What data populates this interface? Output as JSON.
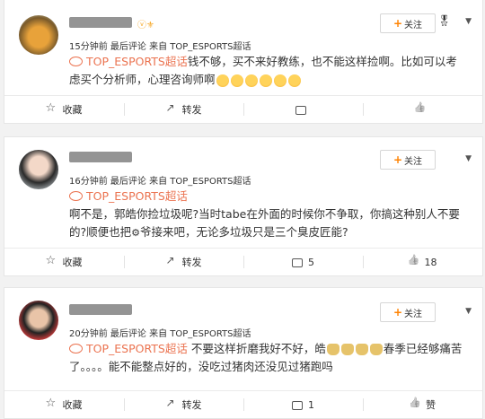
{
  "comments": [
    {
      "meta": "15分钟前 最后评论 来自 TOP_ESPORTS超话",
      "follow_label": "关注",
      "topic": "TOP_ESPORTS超话",
      "text_line1": "钱不够，买不来好教练，也不能这样捡啊。比如可以考",
      "text_line2": "虑买个分析师，心理咨询师啊",
      "actions": {
        "collect": "收藏",
        "repost": "转发",
        "comment": "",
        "like": ""
      }
    },
    {
      "meta": "16分钟前 最后评论 来自 TOP_ESPORTS超话",
      "follow_label": "关注",
      "topic": "TOP_ESPORTS超话",
      "text_line1": "啊不是，郭皓你捡垃圾呢?当时tabe在外面的时候你不争取，你搞这种别人不要",
      "text_line2a": "的?顺便也把",
      "text_line2b": "爷接来吧，无论多垃圾只是三个臭皮匠能?",
      "actions": {
        "collect": "收藏",
        "repost": "转发",
        "comment": "5",
        "like": "18"
      }
    },
    {
      "meta": "20分钟前 最后评论 来自 TOP_ESPORTS超话",
      "follow_label": "关注",
      "topic": "TOP_ESPORTS超话",
      "text_line1a": "不要这样折磨我好不好，皓",
      "text_line1b": "春季已经够痛苦",
      "text_line2": "了。。。。能不能整点好的，没吃过猪肉还没见过猪跑吗",
      "actions": {
        "collect": "收藏",
        "repost": "转发",
        "comment": "1",
        "like": "赞"
      }
    }
  ]
}
